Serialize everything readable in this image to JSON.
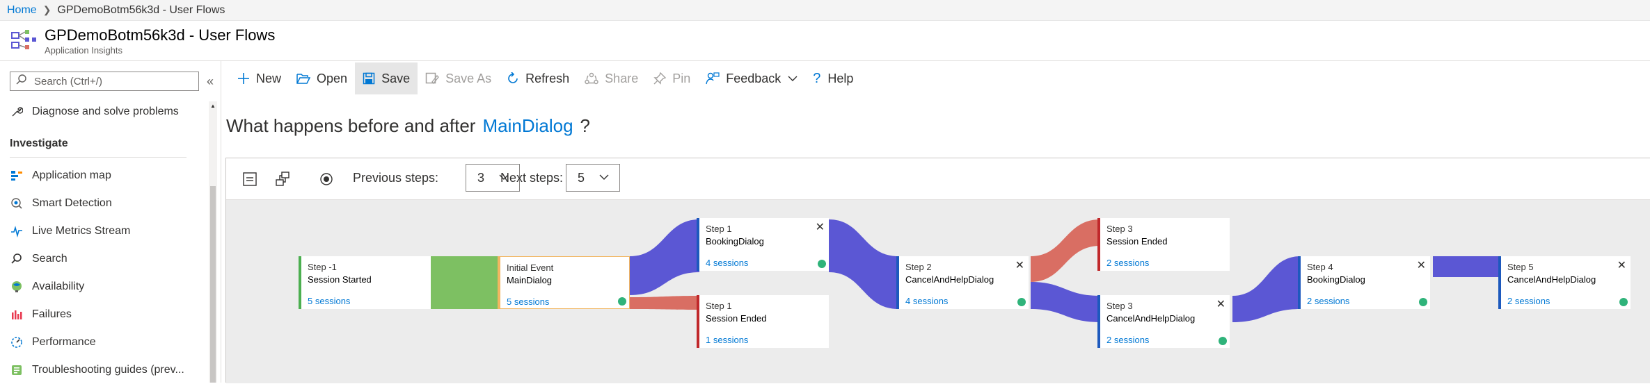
{
  "breadcrumb": {
    "home": "Home",
    "current": "GPDemoBotm56k3d - User Flows"
  },
  "header": {
    "title": "GPDemoBotm56k3d - User Flows",
    "subtitle": "Application Insights"
  },
  "sidebar": {
    "search_placeholder": "Search (Ctrl+/)",
    "diagnose": "Diagnose and solve problems",
    "section": "Investigate",
    "items": [
      {
        "label": "Application map",
        "icon": "application-map-icon"
      },
      {
        "label": "Smart Detection",
        "icon": "smart-detection-icon"
      },
      {
        "label": "Live Metrics Stream",
        "icon": "live-metrics-icon"
      },
      {
        "label": "Search",
        "icon": "search-icon"
      },
      {
        "label": "Availability",
        "icon": "availability-icon"
      },
      {
        "label": "Failures",
        "icon": "failures-icon"
      },
      {
        "label": "Performance",
        "icon": "performance-icon"
      },
      {
        "label": "Troubleshooting guides (prev...",
        "icon": "troubleshooting-icon"
      }
    ]
  },
  "toolbar": {
    "new": "New",
    "open": "Open",
    "save": "Save",
    "save_as": "Save As",
    "refresh": "Refresh",
    "share": "Share",
    "pin": "Pin",
    "feedback": "Feedback",
    "help": "Help"
  },
  "question": {
    "prefix": "What happens before and after",
    "event": "MainDialog",
    "suffix": "?"
  },
  "controls": {
    "previous_label": "Previous steps:",
    "previous_value": "3",
    "next_label": "Next steps:",
    "next_value": "5"
  },
  "nodes": {
    "step_minus1": {
      "step": "Step -1",
      "name": "Session Started",
      "sessions": "5 sessions"
    },
    "initial": {
      "step": "Initial Event",
      "name": "MainDialog",
      "sessions": "5 sessions"
    },
    "step1_booking": {
      "step": "Step 1",
      "name": "BookingDialog",
      "sessions": "4 sessions"
    },
    "step1_ended": {
      "step": "Step 1",
      "name": "Session Ended",
      "sessions": "1 sessions"
    },
    "step2_cancel": {
      "step": "Step 2",
      "name": "CancelAndHelpDialog",
      "sessions": "4 sessions"
    },
    "step3_ended": {
      "step": "Step 3",
      "name": "Session Ended",
      "sessions": "2 sessions"
    },
    "step3_cancel": {
      "step": "Step 3",
      "name": "CancelAndHelpDialog",
      "sessions": "2 sessions"
    },
    "step4_booking": {
      "step": "Step 4",
      "name": "BookingDialog",
      "sessions": "2 sessions"
    },
    "step5_cancel": {
      "step": "Step 5",
      "name": "CancelAndHelpDialog",
      "sessions": "2 sessions"
    }
  },
  "colors": {
    "accent": "#0078d4",
    "flow_start": "#7dc062",
    "flow_continue": "#5b57d4",
    "flow_end": "#d96e63",
    "status_dot": "#2fb37a"
  }
}
